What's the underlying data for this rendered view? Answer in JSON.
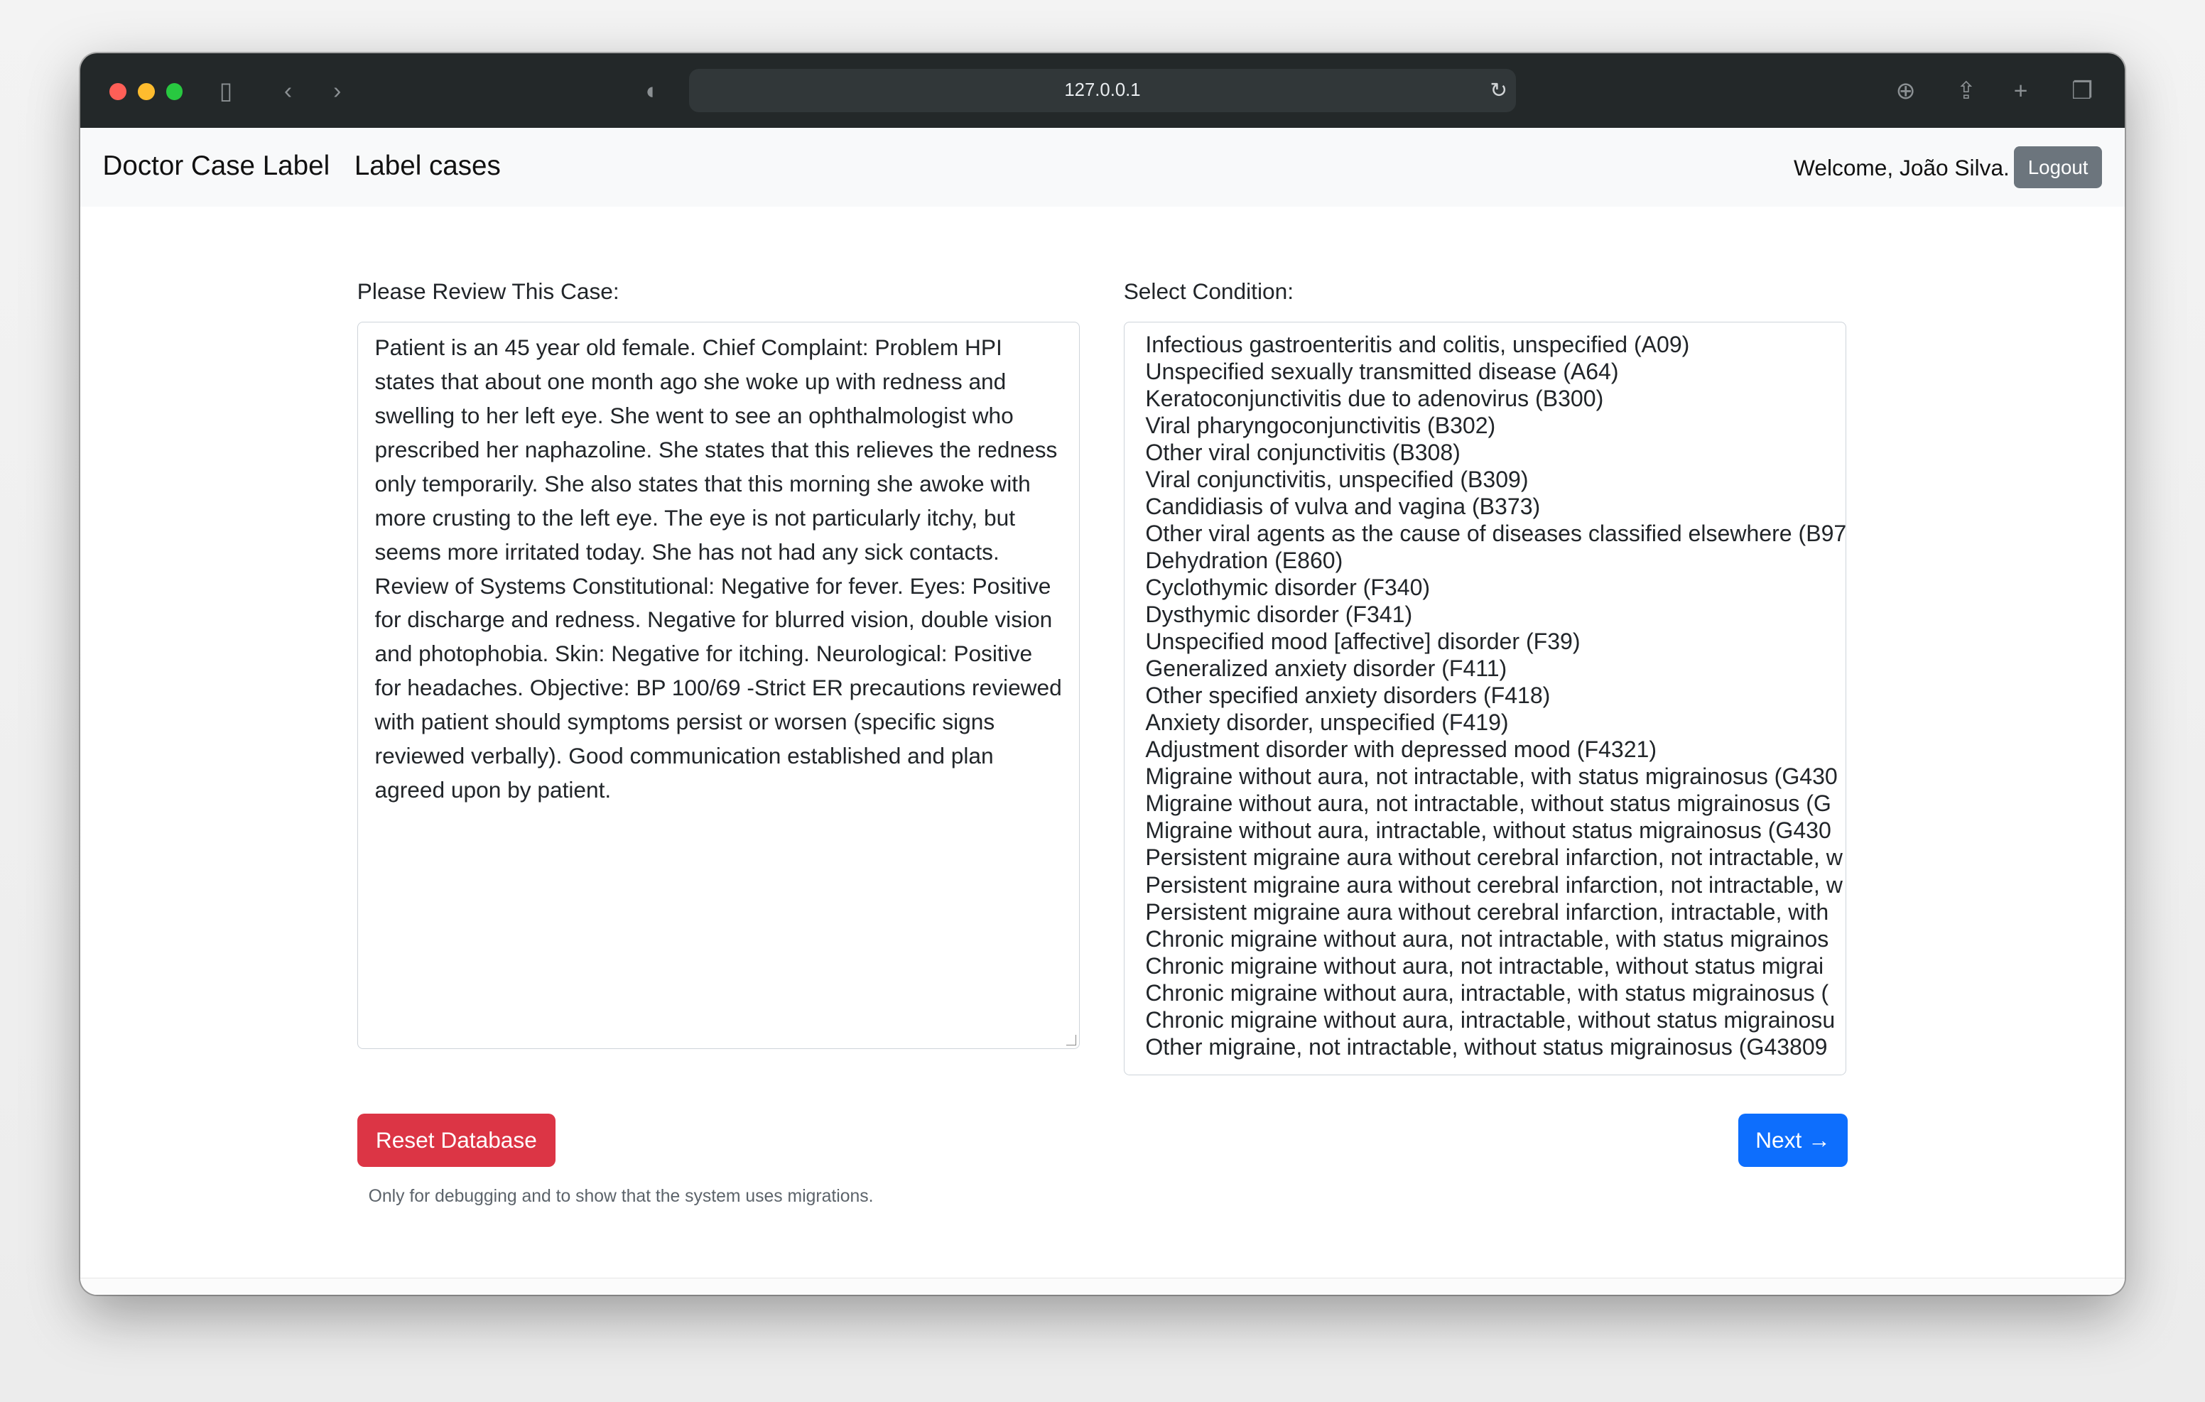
{
  "browser": {
    "url": "127.0.0.1",
    "colors": {
      "close": "#ff5f57",
      "minimize": "#febc2e",
      "zoom": "#28c840"
    }
  },
  "navbar": {
    "brand": "Doctor Case Label",
    "link": "Label cases",
    "welcome": "Welcome, João Silva.",
    "logout": "Logout"
  },
  "case": {
    "label": "Please Review This Case:",
    "text": "Patient  is an 45 year old  female.    Chief Complaint:  Problem    HPI  states that about one month ago she woke up with redness and swelling to her left eye.  She went to see an ophthalmologist who prescribed her naphazoline.  She states that this relieves the redness only temporarily.  She also states that this morning she awoke with more crusting to the left eye.  The eye is not particularly itchy, but seems more irritated today.  She has not had any sick contacts.          Review of Systems   Constitutional: Negative for fever.   Eyes: Positive for discharge and redness. Negative for blurred vision, double vision and photophobia.   Skin: Negative for itching.   Neurological: Positive for headaches.    Objective:     BP 100/69  -Strict ER precautions reviewed with patient should symptoms persist or worsen (specific signs reviewed verbally).  Good communication established and plan agreed upon by patient."
  },
  "condition": {
    "label": "Select Condition:",
    "options": [
      "Infectious gastroenteritis and colitis, unspecified (A09)",
      "Unspecified sexually transmitted disease (A64)",
      "Keratoconjunctivitis due to adenovirus (B300)",
      "Viral pharyngoconjunctivitis (B302)",
      "Other viral conjunctivitis (B308)",
      "Viral conjunctivitis, unspecified (B309)",
      "Candidiasis of vulva and vagina (B373)",
      "Other viral agents as the cause of diseases classified elsewhere (B97",
      "Dehydration (E860)",
      "Cyclothymic disorder (F340)",
      "Dysthymic disorder (F341)",
      "Unspecified mood [affective] disorder (F39)",
      "Generalized anxiety disorder (F411)",
      "Other specified anxiety disorders (F418)",
      "Anxiety disorder, unspecified (F419)",
      "Adjustment disorder with depressed mood (F4321)",
      "Migraine without aura, not intractable, with status migrainosus (G430",
      "Migraine without aura, not intractable, without status migrainosus (G",
      "Migraine without aura, intractable, without status migrainosus (G430",
      "Persistent migraine aura without cerebral infarction, not intractable, w",
      "Persistent migraine aura without cerebral infarction, not intractable, w",
      "Persistent migraine aura without cerebral infarction, intractable, with",
      "Chronic migraine without aura, not intractable, with status migrainos",
      "Chronic migraine without aura, not intractable, without status migrai",
      "Chronic migraine without aura, intractable, with status migrainosus (",
      "Chronic migraine without aura, intractable, without status migrainosu",
      "Other migraine, not intractable, without status migrainosus (G43809"
    ]
  },
  "actions": {
    "reset": "Reset Database",
    "next": "Next →",
    "help": "Only for debugging and to show that the system uses migrations.",
    "colors": {
      "reset": "#dc3545",
      "next": "#0d6efd"
    }
  }
}
